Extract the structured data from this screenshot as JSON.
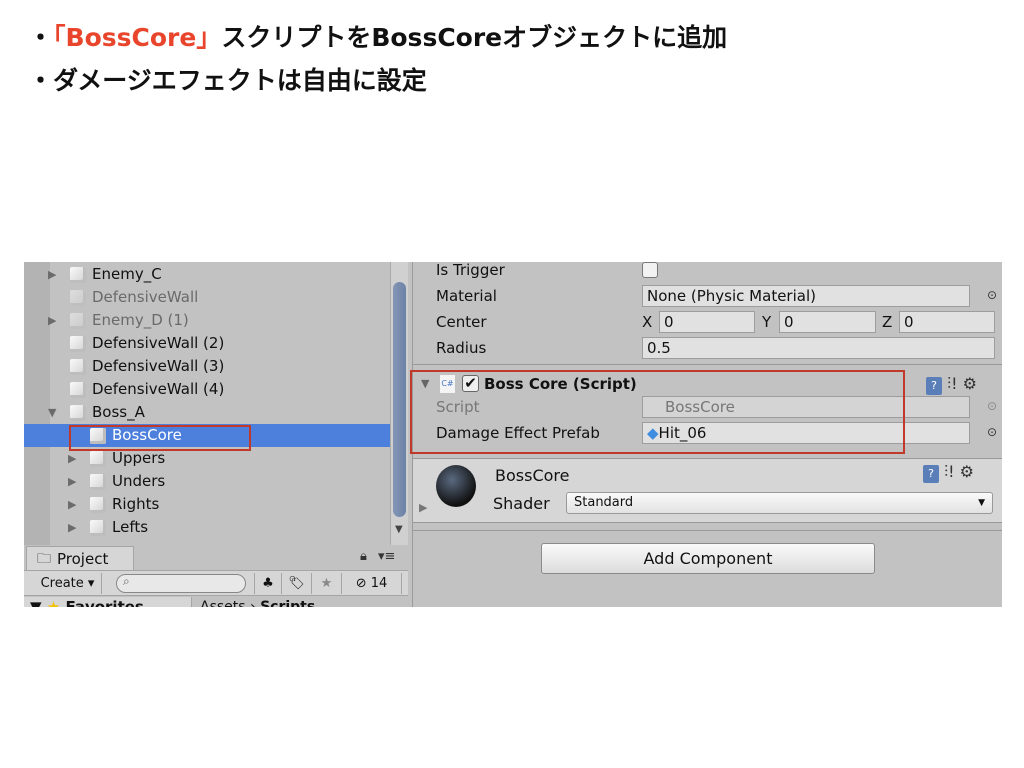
{
  "slide": {
    "bullets": [
      {
        "marker": "・",
        "highlight": "「BossCore」",
        "text": "スクリプトをBossCoreオブジェクトに追加"
      },
      {
        "marker": "・",
        "highlight": "",
        "text": "ダメージエフェクトは自由に設定"
      }
    ],
    "highlight_color": "#e8452c"
  },
  "hierarchy": {
    "items": [
      {
        "label": "Enemy_C",
        "expandable": true,
        "expanded": false,
        "dim": false
      },
      {
        "label": "DefensiveWall",
        "expandable": false,
        "dim": true
      },
      {
        "label": "Enemy_D (1)",
        "expandable": true,
        "expanded": false,
        "dim": true
      },
      {
        "label": "DefensiveWall (2)",
        "expandable": false,
        "dim": false
      },
      {
        "label": "DefensiveWall (3)",
        "expandable": false,
        "dim": false
      },
      {
        "label": "DefensiveWall (4)",
        "expandable": false,
        "dim": false
      },
      {
        "label": "Boss_A",
        "expandable": true,
        "expanded": true,
        "dim": false
      },
      {
        "label": "BossCore",
        "expandable": false,
        "selected": true
      },
      {
        "label": "Uppers",
        "expandable": true,
        "expanded": false
      },
      {
        "label": "Unders",
        "expandable": true,
        "expanded": false
      },
      {
        "label": "Rights",
        "expandable": true,
        "expanded": false
      },
      {
        "label": "Lefts",
        "expandable": true,
        "expanded": false
      }
    ],
    "selection_color": "#4d7fdc"
  },
  "project": {
    "tab_label": "Project",
    "create_label": "Create ▾",
    "hidden_count": "14",
    "favorites_label": "Favorites",
    "breadcrumb": [
      "Assets",
      "Scripts"
    ]
  },
  "inspector": {
    "is_trigger_label": "Is Trigger",
    "is_trigger": false,
    "material_label": "Material",
    "material_value": "None (Physic Material)",
    "center_label": "Center",
    "center": {
      "x_label": "X",
      "x": "0",
      "y_label": "Y",
      "y": "0",
      "z_label": "Z",
      "z": "0"
    },
    "radius_label": "Radius",
    "radius_value": "0.5",
    "script_component": {
      "title": "Boss Core (Script)",
      "enabled": true,
      "script_label": "Script",
      "script_value": "BossCore",
      "damage_label": "Damage Effect Prefab",
      "damage_value": "Hit_06"
    },
    "material_section": {
      "name": "BossCore",
      "shader_label": "Shader",
      "shader_value": "Standard"
    },
    "add_component_label": "Add Component"
  },
  "annotation_color": "#c0392b"
}
